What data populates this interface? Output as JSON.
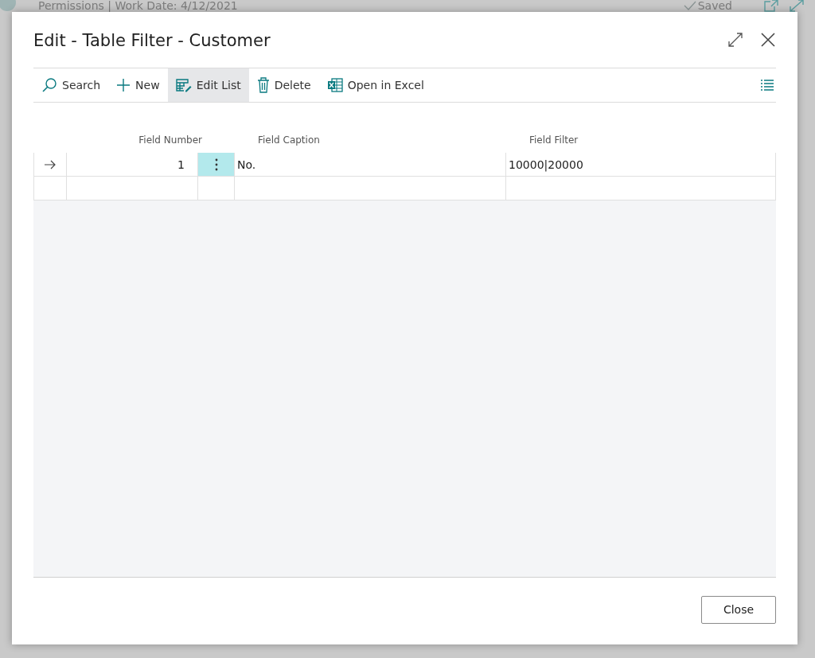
{
  "background": {
    "title": "Permissions | Work Date: 4/12/2021",
    "status": "Saved"
  },
  "dialog": {
    "title": "Edit - Table Filter - Customer"
  },
  "toolbar": [
    {
      "label": "Search",
      "kind": "search",
      "selected": false
    },
    {
      "label": "New",
      "kind": "new",
      "selected": false
    },
    {
      "label": "Edit List",
      "kind": "edit",
      "selected": true
    },
    {
      "label": "Delete",
      "kind": "delete",
      "selected": false
    },
    {
      "label": "Open in Excel",
      "kind": "excel",
      "selected": false
    }
  ],
  "table": {
    "columns": [
      "Field Number",
      "Field Caption",
      "Field Filter"
    ],
    "rows": [
      {
        "field_number": "1",
        "field_caption": "No.",
        "field_filter": "10000|20000",
        "selected": true
      },
      {
        "selected": false
      }
    ]
  },
  "buttons": [
    "Close"
  ]
}
